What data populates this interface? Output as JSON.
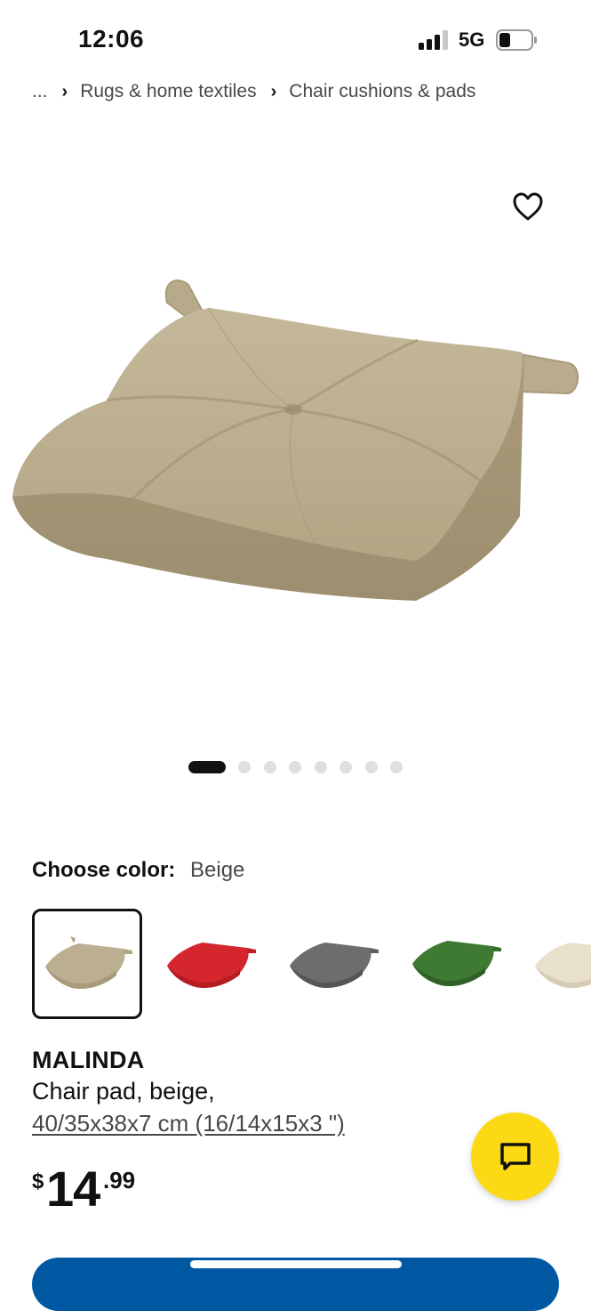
{
  "status_bar": {
    "time": "12:06",
    "network": "5G",
    "signal_icon": "signal-bars-icon",
    "battery_icon": "battery-icon",
    "battery_level": 0.3
  },
  "breadcrumb": {
    "ellipsis": "...",
    "items": [
      "Rugs & home textiles",
      "Chair cushions & pads"
    ],
    "separator_icon": "chevron-right-icon"
  },
  "product_image": {
    "favorite_icon": "heart-icon",
    "carousel_total": 8,
    "carousel_active_index": 0
  },
  "color_chooser": {
    "label": "Choose color:",
    "selected": "Beige",
    "swatches": [
      {
        "name": "beige",
        "color": "#bcaf91"
      },
      {
        "name": "red",
        "color": "#d5262e"
      },
      {
        "name": "dark-gray",
        "color": "#6d6d6d"
      },
      {
        "name": "green",
        "color": "#3f7a33"
      },
      {
        "name": "natural",
        "color": "#e9e0cc"
      }
    ]
  },
  "product": {
    "name": "MALINDA",
    "description": "Chair pad, beige,",
    "size": "40/35x38x7 cm (16/14x15x3 \")"
  },
  "price": {
    "currency": "$",
    "integer": "14",
    "decimal": ".99"
  },
  "chat": {
    "icon": "chat-bubble-icon",
    "color": "#fbd914"
  },
  "colors": {
    "primary_cta": "#0058a3",
    "text": "#111111",
    "muted_text": "#484848"
  }
}
